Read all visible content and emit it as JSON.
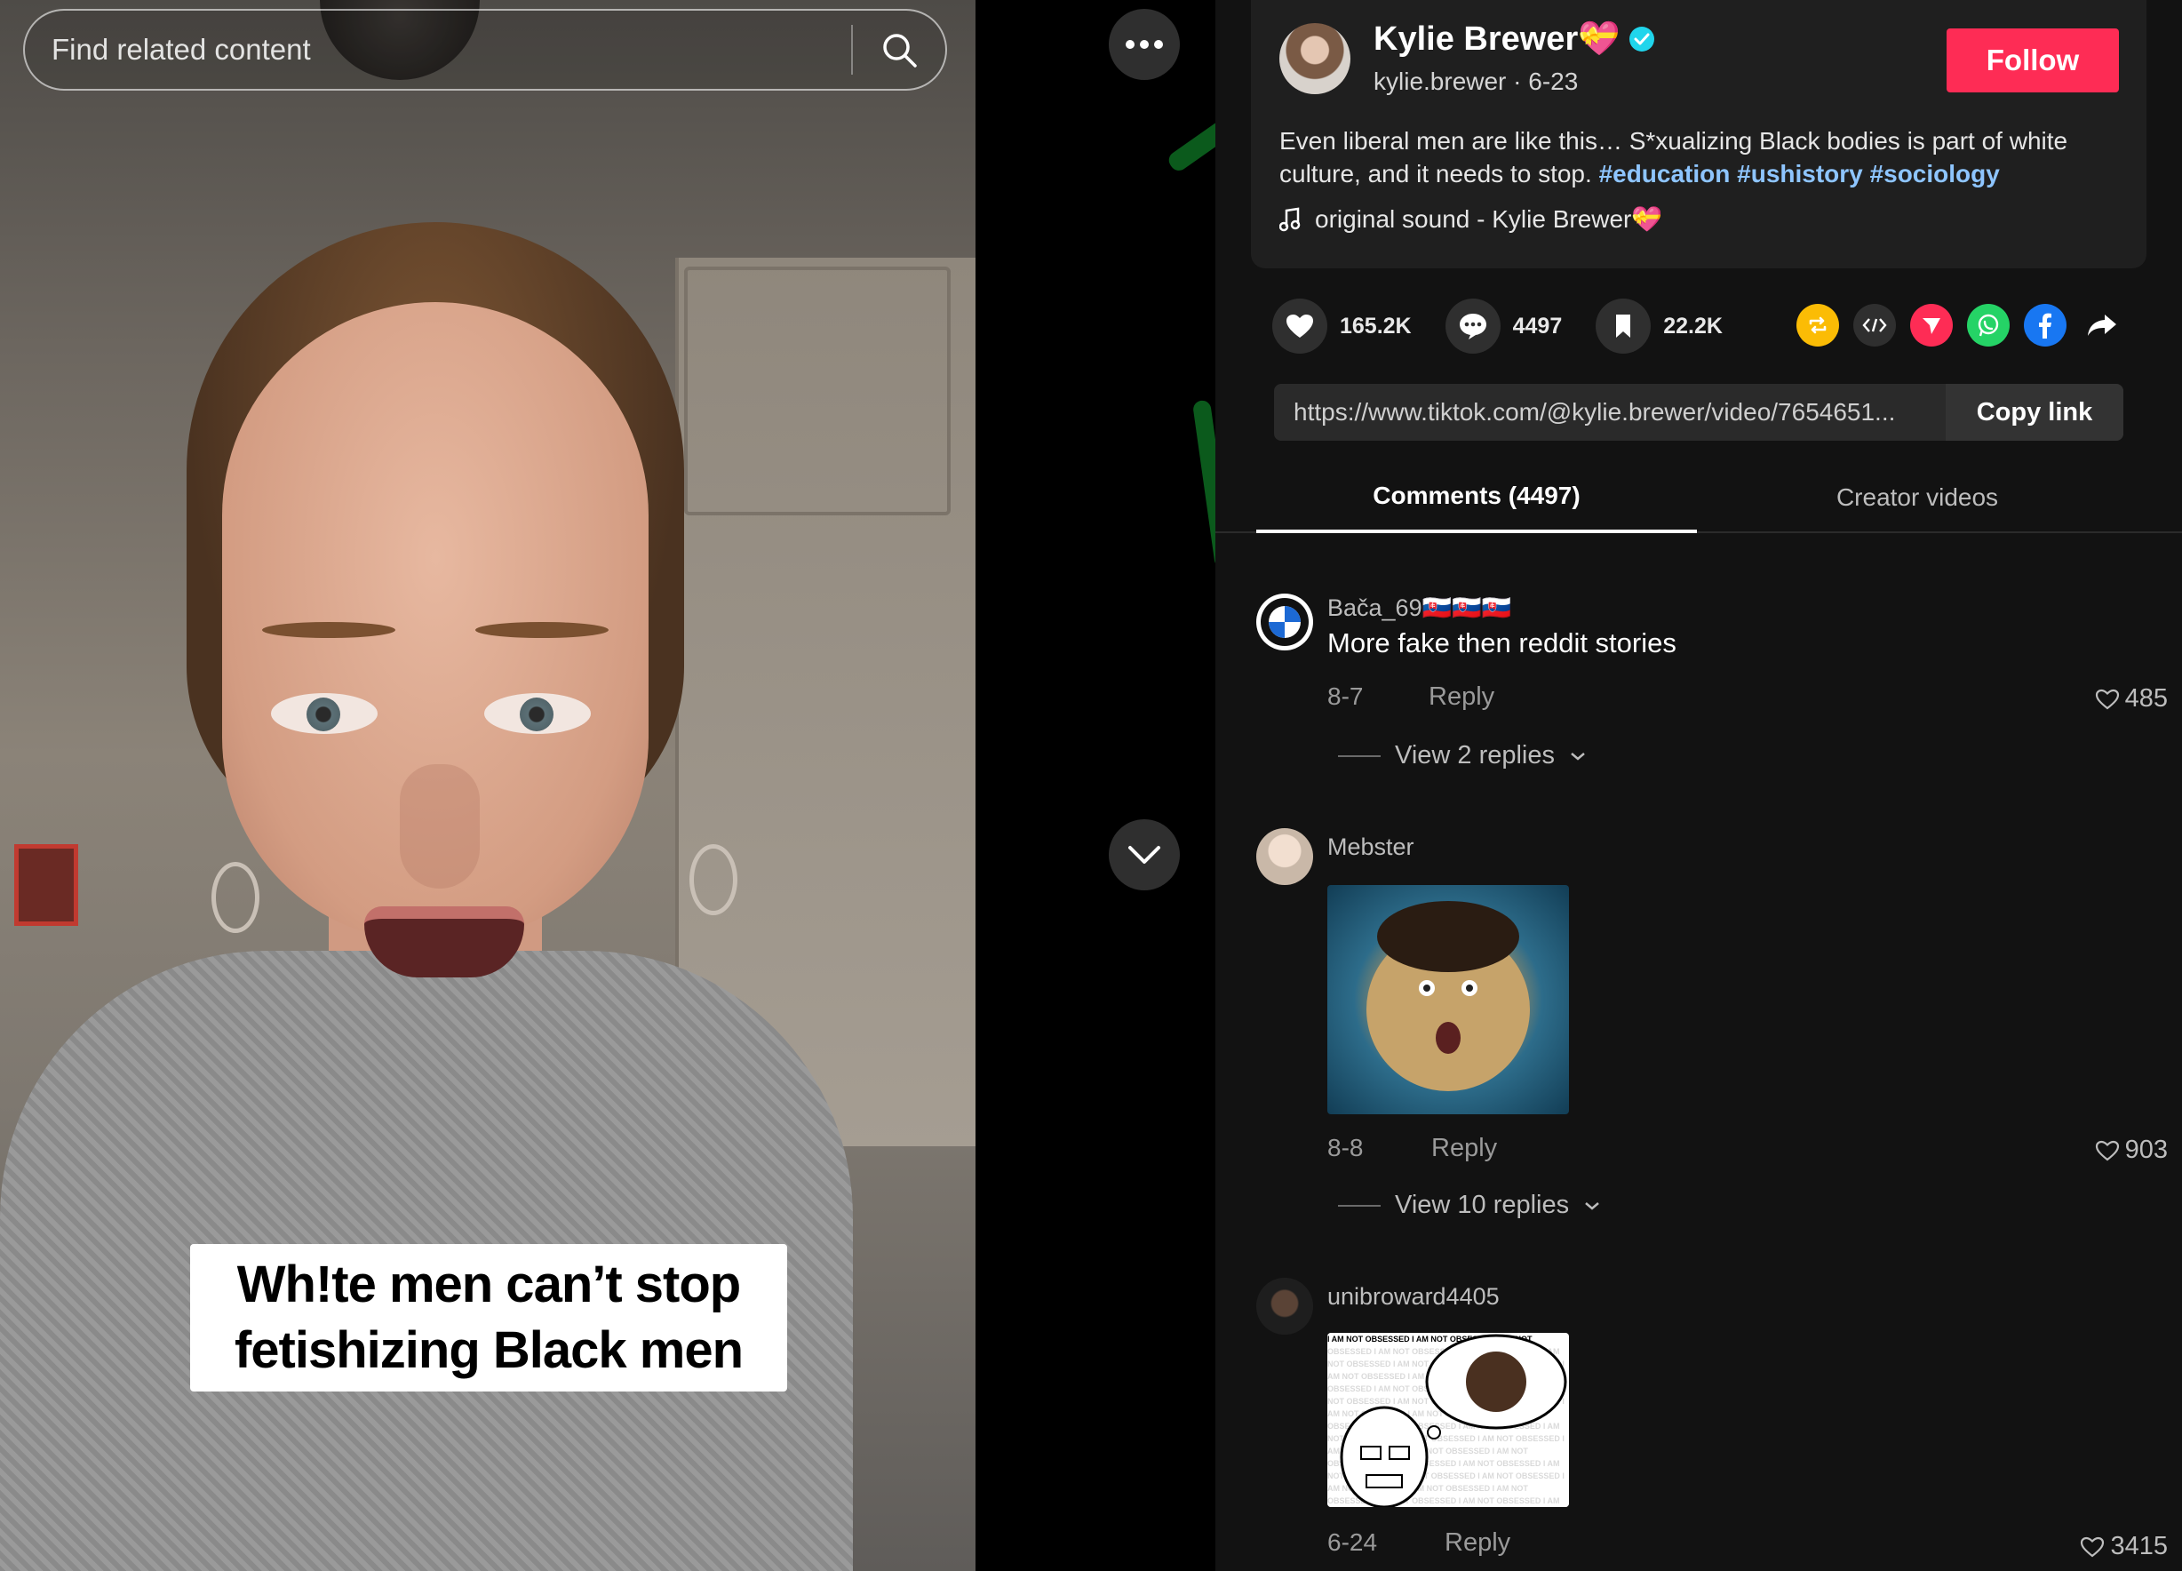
{
  "search": {
    "placeholder": "Find related content"
  },
  "video": {
    "caption_lines": [
      "Wh!te men can’t stop",
      "fetishizing Black men"
    ]
  },
  "creator": {
    "display_name": "Kylie Brewer💝",
    "handle_date": "kylie.brewer · 6-23",
    "verified": true,
    "follow_label": "Follow"
  },
  "description": {
    "text": "Even liberal men are like this… S*xualizing Black bodies is part of white culture, and it needs to stop.",
    "hashtags": [
      "#education",
      "#ushistory",
      "#sociology"
    ]
  },
  "sound": {
    "label": "original sound - Kylie Brewer💝"
  },
  "actions": {
    "likes": "165.2K",
    "comments": "4497",
    "saves": "22.2K"
  },
  "share_icons": [
    "repost-icon",
    "embed-icon",
    "send-icon",
    "whatsapp-icon",
    "facebook-icon",
    "share-arrow-icon"
  ],
  "link": {
    "url": "https://www.tiktok.com/@kylie.brewer/video/7654651...",
    "copy_label": "Copy link"
  },
  "tabs": [
    {
      "label": "Comments (4497)",
      "active": true
    },
    {
      "label": "Creator videos",
      "active": false
    }
  ],
  "comments": [
    {
      "user": "Bača_69🇸🇰🇸🇰🇸🇰",
      "text": "More fake then reddit stories",
      "date": "8-7",
      "reply_label": "Reply",
      "likes": "485",
      "view_replies": "View 2 replies"
    },
    {
      "user": "Mebster",
      "text": "",
      "date": "8-8",
      "reply_label": "Reply",
      "likes": "903",
      "view_replies": "View 10 replies",
      "image": "pufferfish-face-meme"
    },
    {
      "user": "unibroward4405",
      "text": "",
      "date": "6-24",
      "reply_label": "Reply",
      "likes": "3415",
      "image": "i-am-not-obsessed-meme",
      "image_text": "I AM NOT OBSESSED"
    }
  ],
  "colors": {
    "follow": "#fe2c55",
    "hashtag": "#8ec5ff",
    "verified": "#20d5ec",
    "panel_bg": "#121212"
  }
}
